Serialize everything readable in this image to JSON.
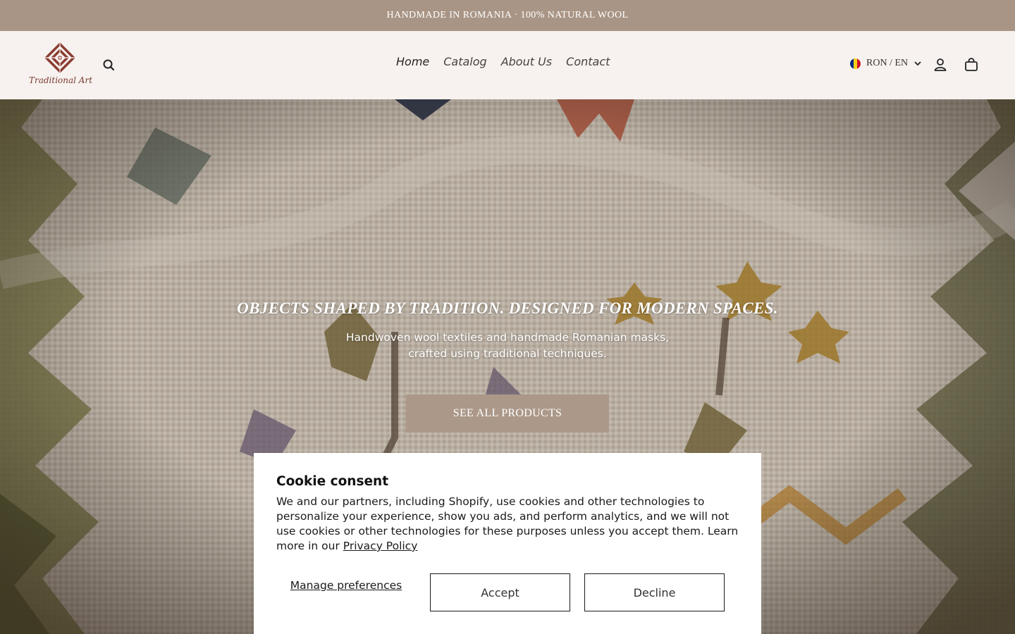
{
  "announcement": "HANDMADE IN ROMANIA · 100% NATURAL WOOL",
  "header": {
    "logo_text": "Traditional Art",
    "search_icon": "search-icon",
    "nav": [
      {
        "label": "Home",
        "active": true
      },
      {
        "label": "Catalog",
        "active": false
      },
      {
        "label": "About Us",
        "active": false
      },
      {
        "label": "Contact",
        "active": false
      }
    ],
    "locale_label": "RON / EN",
    "flag_colors": [
      "#002b7f",
      "#fcd116",
      "#ce1126"
    ],
    "account_icon": "user-icon",
    "cart_icon": "shopping-bag-icon"
  },
  "hero": {
    "title": "OBJECTS SHAPED BY TRADITION. DESIGNED FOR MODERN SPACES.",
    "subtitle_line1": "Handwoven wool textiles and handmade Romanian masks,",
    "subtitle_line2": "crafted using traditional techniques.",
    "cta_label": "SEE ALL PRODUCTS"
  },
  "cookie": {
    "title": "Cookie consent",
    "body": "We and our partners, including Shopify, use cookies and other technologies to personalize your experience, show you ads, and perform analytics, and we will not use cookies or other technologies for these purposes unless you accept them. Learn more in our ",
    "privacy_link": "Privacy Policy",
    "manage_label": "Manage preferences",
    "accept_label": "Accept",
    "decline_label": "Decline"
  },
  "colors": {
    "announcement_bg": "#a99585",
    "header_bg": "#f7f2ef",
    "cta_bg": "#ab9888",
    "logo_red": "#7a3a30"
  }
}
